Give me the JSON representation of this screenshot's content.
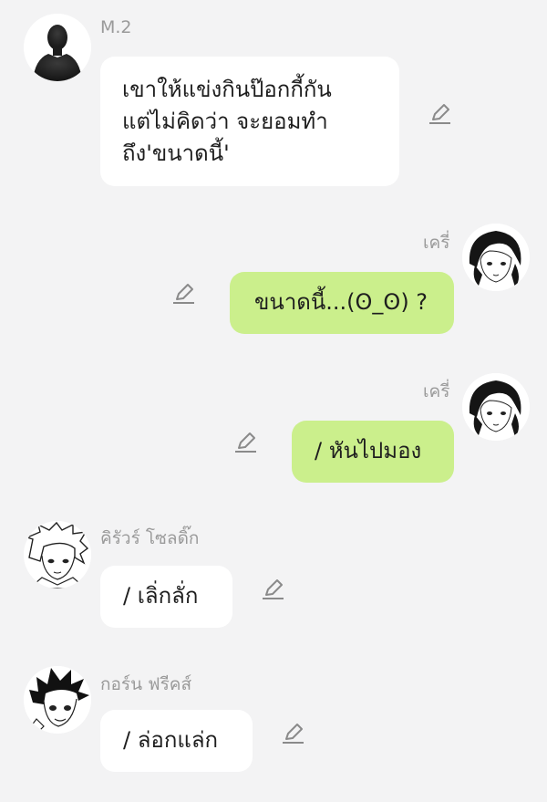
{
  "messages": [
    {
      "sender": "M.2",
      "text": "เขาให้แข่งกินป๊อกกี้กัน\nแต่ไม่คิดว่า จะยอมทำ\nถึง'ขนาดนี้'",
      "side": "left",
      "avatar": "silhouette-avatar"
    },
    {
      "sender": "เครี่",
      "text": "ขนาดนี้...(ʘ_ʘ) ?",
      "side": "right",
      "avatar": "manga-avatar-kurapika"
    },
    {
      "sender": "เครี่",
      "text": "/ หันไปมอง",
      "side": "right",
      "avatar": "manga-avatar-kurapika"
    },
    {
      "sender": "คิรัวร์ โซลดิ๊ก",
      "text": "/ เลิ่กลั่ก",
      "side": "left",
      "avatar": "manga-avatar-killua"
    },
    {
      "sender": "กอร์น ฟรีคส์",
      "text": "/ ล่อกแล่ก",
      "side": "left",
      "avatar": "manga-avatar-gon"
    }
  ],
  "edit_icon": "pencil-edit-icon",
  "colors": {
    "background": "#f3f3f4",
    "incoming_bubble": "#ffffff",
    "outgoing_bubble": "#cbef8c",
    "sender_text": "#9a9a9a",
    "message_text": "#1e1e1e"
  }
}
